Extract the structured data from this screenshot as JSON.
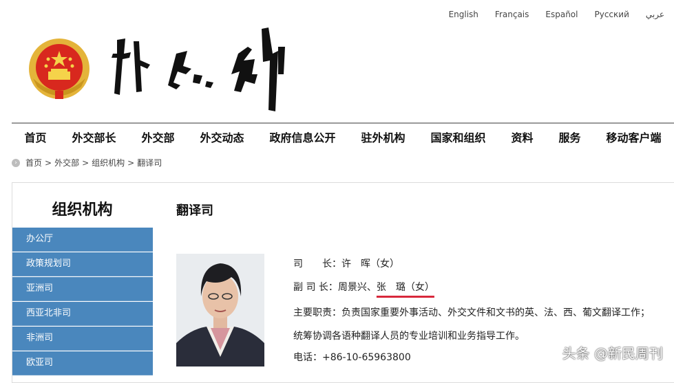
{
  "languages": [
    "English",
    "Français",
    "Español",
    "Русский",
    "عربي"
  ],
  "nav": [
    "首页",
    "外交部长",
    "外交部",
    "外交动态",
    "政府信息公开",
    "驻外机构",
    "国家和组织",
    "资料",
    "服务",
    "移动客户端"
  ],
  "breadcrumb": [
    "首页",
    "外交部",
    "组织机构",
    "翻译司"
  ],
  "breadcrumb_sep": ">",
  "sidebar": {
    "title": "组织机构",
    "items": [
      "办公厅",
      "政策规划司",
      "亚洲司",
      "西亚北非司",
      "非洲司",
      "欧亚司"
    ]
  },
  "main": {
    "title": "翻译司",
    "director_label": "司　　长：",
    "director_name": "许　晖（女）",
    "deputy_label": "副 司 长：",
    "deputy_names_plain": "周景兴、",
    "deputy_names_highlight": "张　璐（女）",
    "duties_label": "主要职责：",
    "duties_text": "负责国家重要外事活动、外交文件和文书的英、法、西、葡文翻译工作；统筹协调各语种翻译人员的专业培训和业务指导工作。",
    "phone_label": "电话：",
    "phone_value": "+86-10-65963800"
  },
  "watermark": "头条 @新民周刊",
  "colors": {
    "sidebar_bg": "#4a87bd",
    "highlight_underline": "#d8283b",
    "nav_border": "#9a9a9a"
  }
}
